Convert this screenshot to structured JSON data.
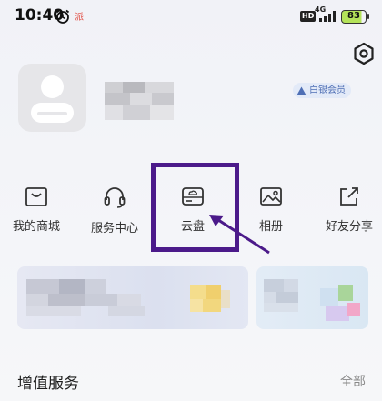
{
  "status_bar": {
    "time": "10:40",
    "alarm_icon": "alarm-icon",
    "notice_tag": "派",
    "hd_label": "HD",
    "network_label": "4G",
    "battery_level": "83",
    "battery_fraction": 0.83
  },
  "header": {
    "settings_icon": "hexagon-settings-icon"
  },
  "profile": {
    "avatar_icon": "default-avatar-icon",
    "member_badge": "白银会员",
    "member_icon": "triangle-mountain-icon"
  },
  "shortcuts": [
    {
      "icon": "mall-icon",
      "label": "我的商城"
    },
    {
      "icon": "headset-icon",
      "label": "服务中心"
    },
    {
      "icon": "cloud-drive-icon",
      "label": "云盘"
    },
    {
      "icon": "photo-album-icon",
      "label": "相册"
    },
    {
      "icon": "share-icon",
      "label": "好友分享"
    }
  ],
  "annotation": {
    "highlight_color": "#4b1a8a"
  },
  "section": {
    "title": "增值服务",
    "more_label": "全部"
  },
  "colors": {
    "accent": "#4b1a8a",
    "badge_text": "#4f6fb5",
    "badge_bg": "#e3eaf8"
  }
}
